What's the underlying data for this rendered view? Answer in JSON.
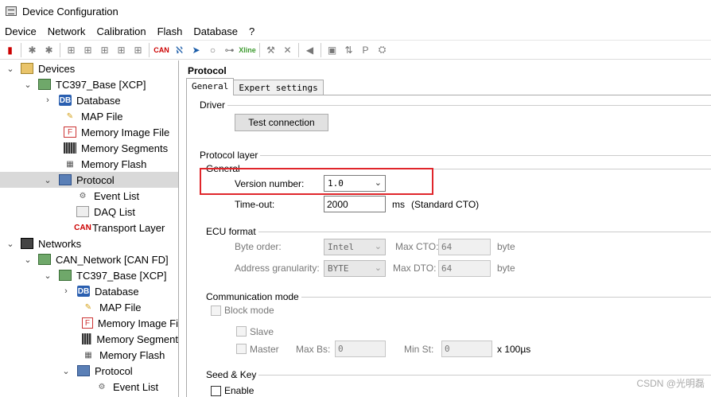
{
  "window": {
    "title": "Device Configuration"
  },
  "menu": [
    "Device",
    "Network",
    "Calibration",
    "Flash",
    "Database",
    "?"
  ],
  "toolbar": {
    "can_label": "CAN",
    "xline_label": "Xline"
  },
  "tree": {
    "devices": "Devices",
    "tc397_xcp": "TC397_Base [XCP]",
    "database": "Database",
    "map_file": "MAP File",
    "memory_image_file": "Memory Image File",
    "memory_segments": "Memory Segments",
    "memory_flash": "Memory Flash",
    "protocol": "Protocol",
    "event_list": "Event List",
    "daq_list": "DAQ List",
    "transport_layer": "Transport Layer",
    "networks": "Networks",
    "can_network": "CAN_Network [CAN FD]",
    "net_tc397": "TC397_Base [XCP]",
    "net_database": "Database",
    "net_map_file": "MAP File",
    "net_memory_image_file": "Memory Image Fi",
    "net_memory_segments": "Memory Segment",
    "net_memory_flash": "Memory Flash",
    "net_protocol": "Protocol",
    "net_event_list": "Event List",
    "can_icon": "CAN",
    "db_icon": "DB",
    "mem_icon": "F"
  },
  "panel": {
    "title": "Protocol",
    "tabs": [
      "General",
      "Expert settings"
    ],
    "driver": {
      "label": "Driver",
      "test_button": "Test connection"
    },
    "protocol_layer": {
      "label": "Protocol layer",
      "general_label": "General",
      "version_label": "Version number:",
      "version_value": "1.0",
      "timeout_label": "Time-out:",
      "timeout_value": "2000",
      "timeout_unit": "ms",
      "timeout_note": "(Standard CTO)"
    },
    "ecu_format": {
      "label": "ECU format",
      "byte_order_label": "Byte order:",
      "byte_order_value": "Intel",
      "max_cto_label": "Max CTO:",
      "max_cto_value": "64",
      "max_cto_unit": "byte",
      "addr_gran_label": "Address granularity:",
      "addr_gran_value": "BYTE",
      "max_dto_label": "Max DTO:",
      "max_dto_value": "64",
      "max_dto_unit": "byte"
    },
    "comm_mode": {
      "label": "Communication mode",
      "block_mode": "Block mode",
      "slave": "Slave",
      "master": "Master",
      "max_bs_label": "Max Bs:",
      "max_bs_value": "0",
      "min_st_label": "Min St:",
      "min_st_value": "0",
      "min_st_unit": "x 100µs"
    },
    "seed_key": {
      "label": "Seed & Key",
      "enable": "Enable"
    }
  },
  "watermark": "CSDN @光明磊",
  "colors": {
    "highlight": "#e0262b",
    "selected": "#d9d9d9"
  }
}
